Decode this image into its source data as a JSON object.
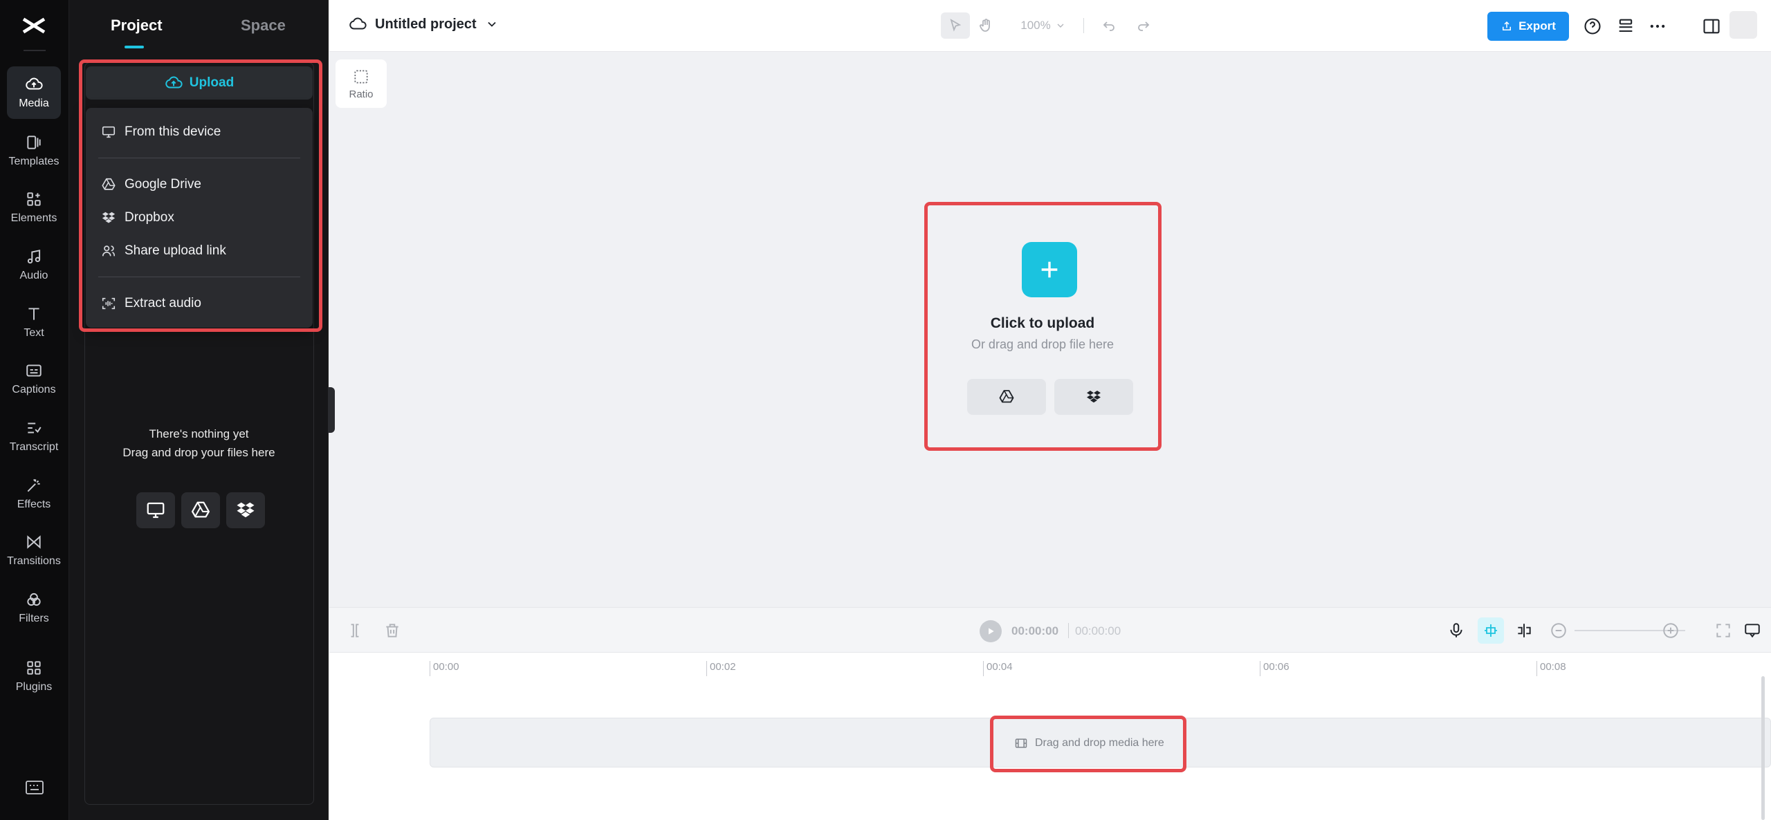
{
  "rail": {
    "items": [
      {
        "label": "Media",
        "icon": "cloud-upload-icon",
        "active": true
      },
      {
        "label": "Templates",
        "icon": "templates-icon"
      },
      {
        "label": "Elements",
        "icon": "elements-icon"
      },
      {
        "label": "Audio",
        "icon": "music-note-icon"
      },
      {
        "label": "Text",
        "icon": "text-icon"
      },
      {
        "label": "Captions",
        "icon": "captions-icon"
      },
      {
        "label": "Transcript",
        "icon": "transcript-icon"
      },
      {
        "label": "Effects",
        "icon": "effects-icon"
      },
      {
        "label": "Transitions",
        "icon": "transitions-icon"
      },
      {
        "label": "Filters",
        "icon": "filters-icon"
      },
      {
        "label": "Plugins",
        "icon": "plugins-icon"
      }
    ]
  },
  "panel": {
    "tabs": [
      "Project",
      "Space"
    ],
    "upload_label": "Upload",
    "menu": {
      "from_device": "From this device",
      "google_drive": "Google Drive",
      "dropbox": "Dropbox",
      "share_link": "Share upload link",
      "extract_audio": "Extract audio"
    },
    "empty_line1": "There's nothing yet",
    "empty_line2": "Drag and drop your files here"
  },
  "topbar": {
    "project_title": "Untitled project",
    "zoom": "100%",
    "export_label": "Export"
  },
  "canvas": {
    "ratio_label": "Ratio",
    "upload_title": "Click to upload",
    "upload_subtitle": "Or drag and drop file here"
  },
  "controls": {
    "current_time": "00:00:00",
    "total_time": "00:00:00"
  },
  "timeline": {
    "ticks": [
      "00:00",
      "00:02",
      "00:04",
      "00:06",
      "00:08"
    ],
    "drop_hint": "Drag and drop media here"
  },
  "colors": {
    "accent": "#20c4e0",
    "export": "#1a8ef0",
    "highlight": "#e5484d"
  }
}
